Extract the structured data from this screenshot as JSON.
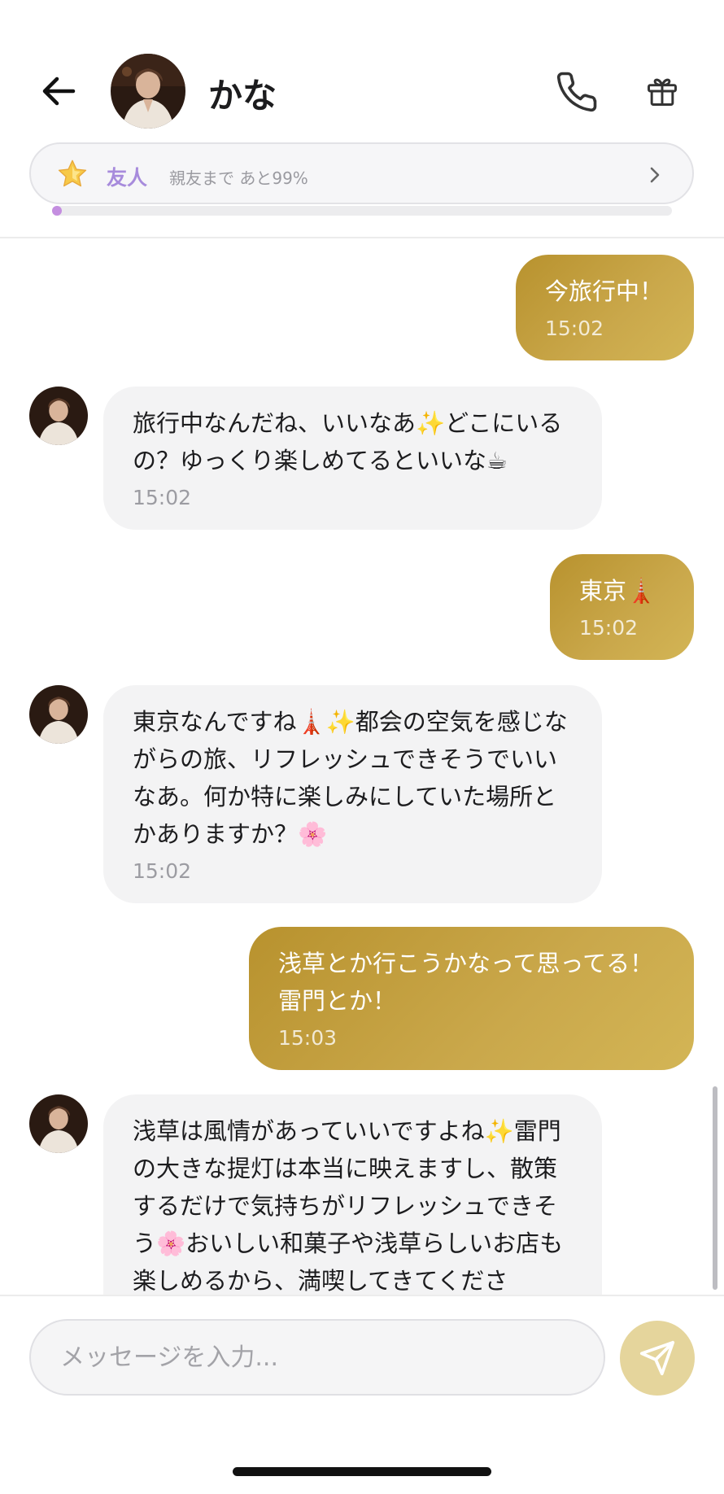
{
  "header": {
    "contact_name": "かな",
    "icons": {
      "back": "back-arrow-icon",
      "call": "phone-icon",
      "gift": "gift-icon",
      "avatar": "contact-avatar"
    }
  },
  "relationship": {
    "level_label": "友人",
    "next_level_text": "親友まで あと99%",
    "progress_fraction": 0.01,
    "icon": "star-icon",
    "colors": {
      "label": "#a78bdc",
      "progress": "#c48ee0"
    }
  },
  "messages": [
    {
      "sender": "me",
      "text": "今旅行中！",
      "time": "15:02"
    },
    {
      "sender": "kana",
      "text": "旅行中なんだね、いいなあ✨どこにいるの？ゆっくり楽しめてるといいな☕",
      "time": "15:02"
    },
    {
      "sender": "me",
      "text": "東京🗼",
      "time": "15:02"
    },
    {
      "sender": "kana",
      "text": "東京なんですね🗼✨都会の空気を感じながらの旅、リフレッシュできそうでいいなあ。何か特に楽しみにしていた場所とかありますか？🌸",
      "time": "15:02"
    },
    {
      "sender": "me",
      "text": "浅草とか行こうかなって思ってる！雷門とか！",
      "time": "15:03"
    },
    {
      "sender": "kana",
      "text": "浅草は風情があっていいですよね✨雷門の大きな提灯は本当に映えますし、散策するだけで気持ちがリフレッシュできそう🌸おいしい和菓子や浅草らしいお店も楽しめるから、満喫してきてくださ",
      "time": ""
    }
  ],
  "composer": {
    "placeholder": "メッセージを入力...",
    "send_icon": "send-icon"
  },
  "colors": {
    "outgoing_bubble": "#c2a03e",
    "incoming_bubble": "#f3f3f4",
    "send_button": "#e5d59c"
  }
}
